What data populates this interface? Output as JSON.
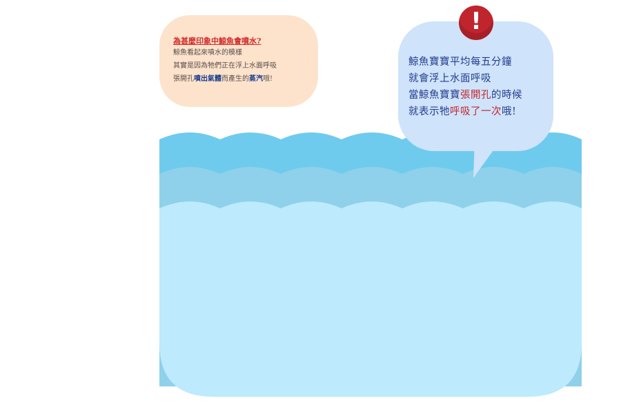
{
  "colors": {
    "wave_top": "#6ecbed",
    "wave_mid": "#8fd1ea",
    "water": "#bdeafd",
    "left_bubble": "#fde3cc",
    "right_bubble": "#cfe3fa",
    "alert_red": "#c0242d",
    "text_blue": "#233d8f",
    "text_red": "#c0282e"
  },
  "left_bubble": {
    "title": "為甚麼印象中鯨魚會噴水?",
    "line1": "鯨魚看起來噴水的模樣",
    "line2": "其實是因為牠們正在浮上水面呼吸",
    "line3_pre": "張開孔",
    "line3_hl1": "噴出氣體",
    "line3_mid": "而產生的",
    "line3_hl2": "蒸汽",
    "line3_post": "哦!"
  },
  "right_bubble": {
    "line1": "鯨魚寶寶平均每五分鐘",
    "line2": "就會浮上水面呼吸",
    "line3_pre": "當鯨魚寶寶",
    "line3_red": "張開孔",
    "line3_post": "的時候",
    "line4_pre": "就表示牠",
    "line4_red": "呼吸了一次",
    "line4_post": "哦!"
  },
  "alert_icon": {
    "symbol": "!"
  }
}
